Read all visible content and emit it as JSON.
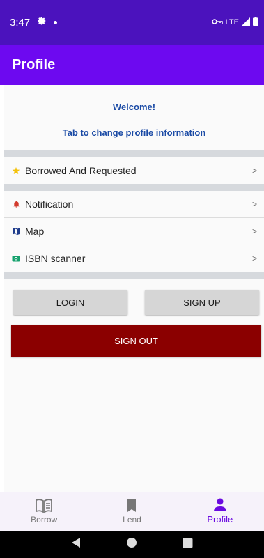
{
  "status_bar": {
    "time": "3:47",
    "network": "LTE",
    "icons": [
      "gear-icon",
      "notification-dot",
      "vpn-key-icon",
      "signal-icon",
      "battery-icon"
    ]
  },
  "app_bar": {
    "title": "Profile"
  },
  "welcome": {
    "line1": "Welcome!",
    "line2": "Tab to change profile information"
  },
  "menu": {
    "borrowed": {
      "label": "Borrowed And Requested",
      "icon": "star-icon",
      "chevron": ">"
    },
    "notification": {
      "label": "Notification",
      "icon": "bell-icon",
      "chevron": ">"
    },
    "map": {
      "label": "Map",
      "icon": "map-icon",
      "chevron": ">"
    },
    "isbn": {
      "label": "ISBN scanner",
      "icon": "camera-icon",
      "chevron": ">"
    }
  },
  "buttons": {
    "login": "LOGIN",
    "signup": "SIGN UP",
    "signout": "SIGN OUT"
  },
  "bottom_nav": {
    "items": [
      {
        "label": "Borrow",
        "icon": "book-icon",
        "active": false
      },
      {
        "label": "Lend",
        "icon": "bookmark-icon",
        "active": false
      },
      {
        "label": "Profile",
        "icon": "person-icon",
        "active": true
      }
    ]
  },
  "colors": {
    "status_bar": "#4b12bd",
    "app_bar": "#6d09f0",
    "accent_active": "#6a0ae0",
    "welcome_text": "#1a4aa5",
    "signout": "#8b0000"
  }
}
